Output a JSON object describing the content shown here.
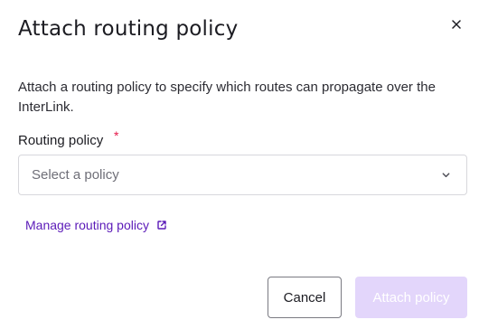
{
  "dialog": {
    "title": "Attach routing policy",
    "close_icon": "close-icon",
    "description": "Attach a routing policy to specify which routes can propagate over the InterLink.",
    "field": {
      "label": "Routing policy",
      "required_mark": "*",
      "placeholder": "Select a policy",
      "chevron_icon": "chevron-down-icon"
    },
    "link": {
      "label": "Manage routing policy",
      "icon": "external-link-icon"
    },
    "buttons": {
      "cancel": "Cancel",
      "attach": "Attach policy"
    }
  },
  "colors": {
    "link": "#5b1ab8",
    "required": "#e5194a",
    "primary_disabled": "#e3d6fb"
  }
}
